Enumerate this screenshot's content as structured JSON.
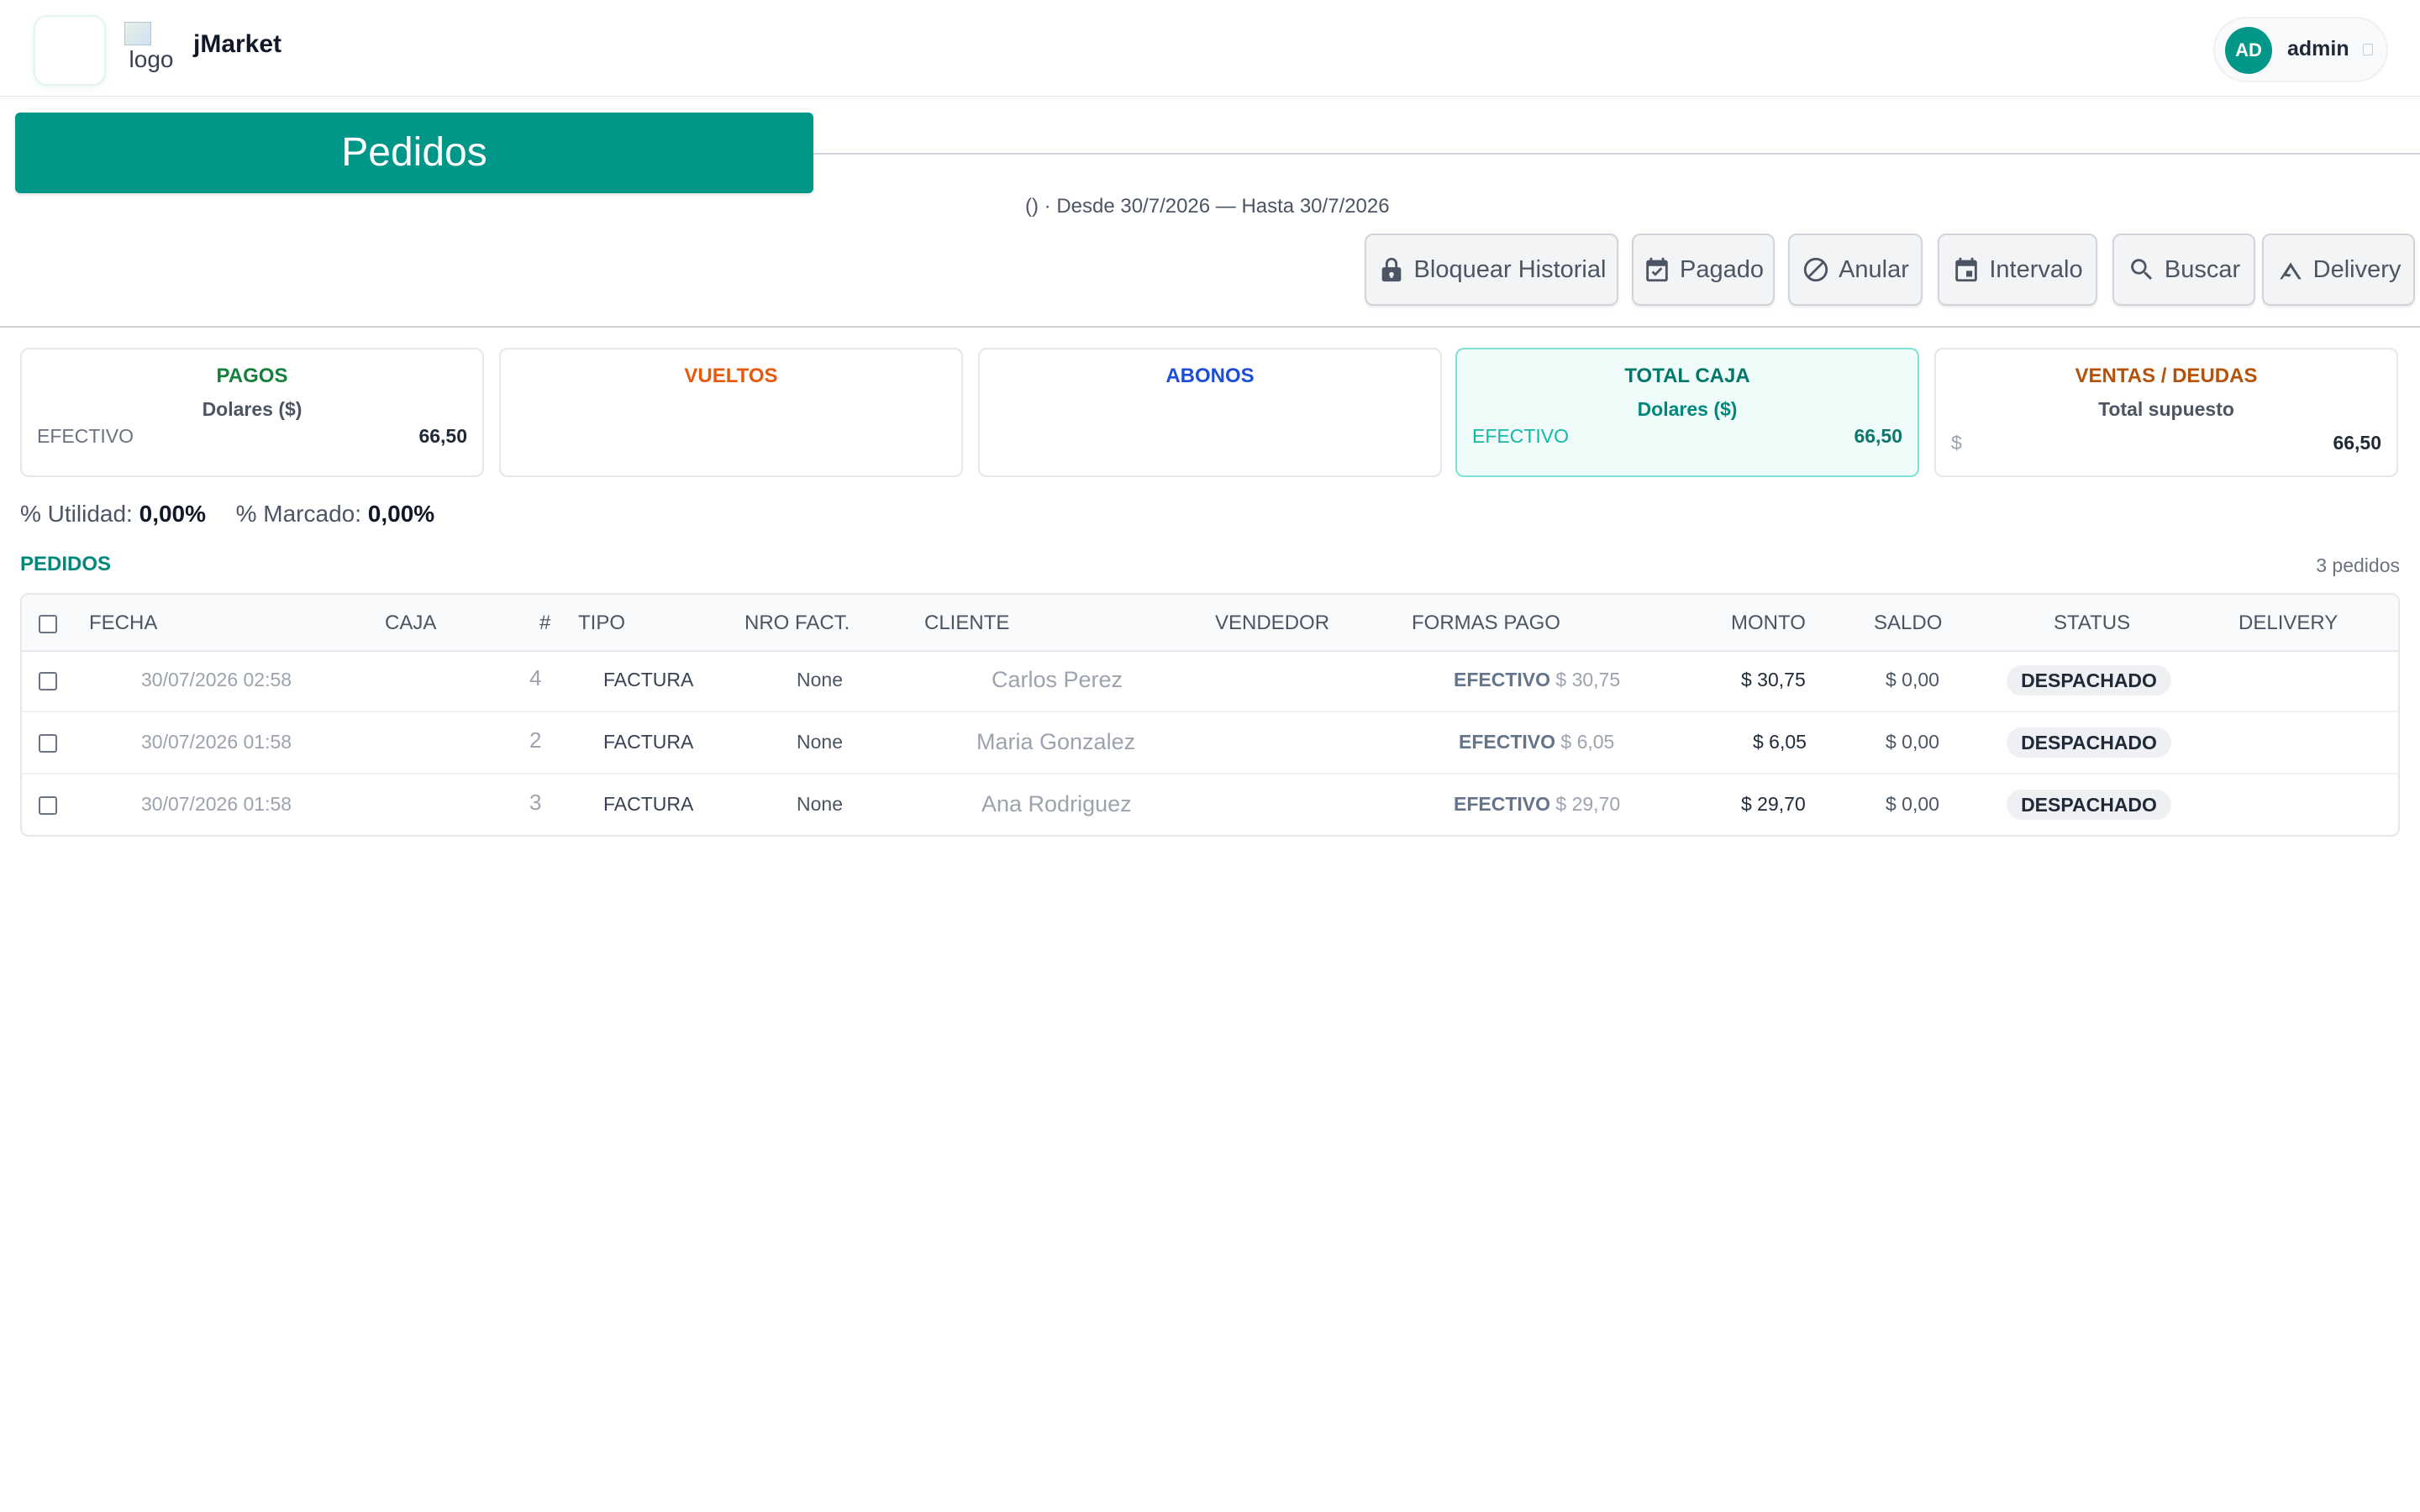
{
  "header": {
    "logo_alt": "logo",
    "app_name": "jMarket",
    "user": {
      "initials": "AD",
      "name": "admin"
    }
  },
  "page": {
    "title": "Pedidos",
    "date_range": "()  ·  Desde 30/7/2026 — Hasta 30/7/2026"
  },
  "toolbar": {
    "bloquear": "Bloquear Historial",
    "pagado": "Pagado",
    "anular": "Anular",
    "intervalo": "Intervalo",
    "buscar": "Buscar",
    "delivery": "Delivery"
  },
  "cards": {
    "pagos": {
      "title": "PAGOS",
      "subtitle": "Dolares ($)",
      "label": "EFECTIVO",
      "value": "66,50",
      "color": "#15803d"
    },
    "vueltos": {
      "title": "VUELTOS",
      "color": "#ea580c"
    },
    "abonos": {
      "title": "ABONOS",
      "color": "#1d4ed8"
    },
    "total": {
      "title": "TOTAL CAJA",
      "subtitle": "Dolares ($)",
      "label": "EFECTIVO",
      "value": "66,50",
      "color": "#00897b"
    },
    "ventas": {
      "title": "VENTAS / DEUDAS",
      "subtitle": "Total supuesto",
      "label": "$",
      "value": "66,50",
      "color": "#b45309"
    }
  },
  "metrics": {
    "utilidad_label": "% Utilidad:",
    "utilidad_value": "0,00%",
    "marcado_label": "% Marcado:",
    "marcado_value": "0,00%"
  },
  "list": {
    "title": "PEDIDOS",
    "count": "3 pedidos",
    "columns": [
      "FECHA",
      "CAJA",
      "#",
      "TIPO",
      "NRO FACT.",
      "CLIENTE",
      "VENDEDOR",
      "FORMAS PAGO",
      "MONTO",
      "SALDO",
      "STATUS",
      "DELIVERY"
    ],
    "rows": [
      {
        "fecha": "30/07/2026 02:58",
        "num": "4",
        "tipo": "FACTURA",
        "nro": "None",
        "cliente": "Carlos Perez",
        "forma": "EFECTIVO",
        "forma_monto": "$ 30,75",
        "monto": "$ 30,75",
        "saldo": "$ 0,00",
        "status": "DESPACHADO"
      },
      {
        "fecha": "30/07/2026 01:58",
        "num": "2",
        "tipo": "FACTURA",
        "nro": "None",
        "cliente": "Maria Gonzalez",
        "forma": "EFECTIVO",
        "forma_monto": "$ 6,05",
        "monto": "$ 6,05",
        "saldo": "$ 0,00",
        "status": "DESPACHADO"
      },
      {
        "fecha": "30/07/2026 01:58",
        "num": "3",
        "tipo": "FACTURA",
        "nro": "None",
        "cliente": "Ana Rodriguez",
        "forma": "EFECTIVO",
        "forma_monto": "$ 29,70",
        "monto": "$ 29,70",
        "saldo": "$ 0,00",
        "status": "DESPACHADO"
      }
    ]
  },
  "colors": {
    "brand": "#009688"
  }
}
